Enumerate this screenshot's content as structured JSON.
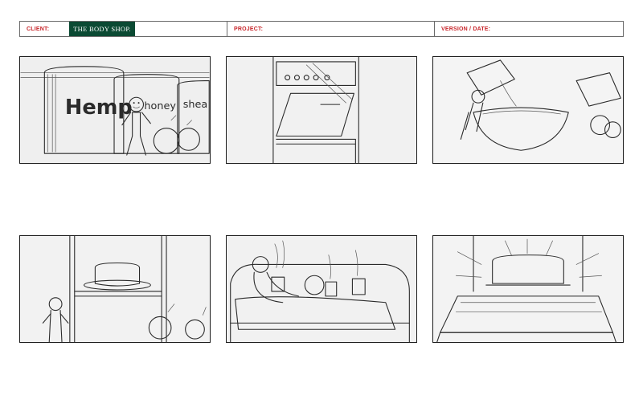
{
  "header": {
    "client_label": "CLIENT:",
    "client_logo": "THE BODY SHOP.",
    "project_label": "PROJECT:",
    "version_label": "VERSION / DATE:"
  },
  "frames": [
    {
      "jar_labels": [
        "Hemp",
        "honey",
        "shea"
      ]
    },
    {},
    {},
    {},
    {},
    {}
  ],
  "colors": {
    "label_red": "#c8262b",
    "logo_green": "#0b4a33",
    "border": "#1a1a1a"
  }
}
